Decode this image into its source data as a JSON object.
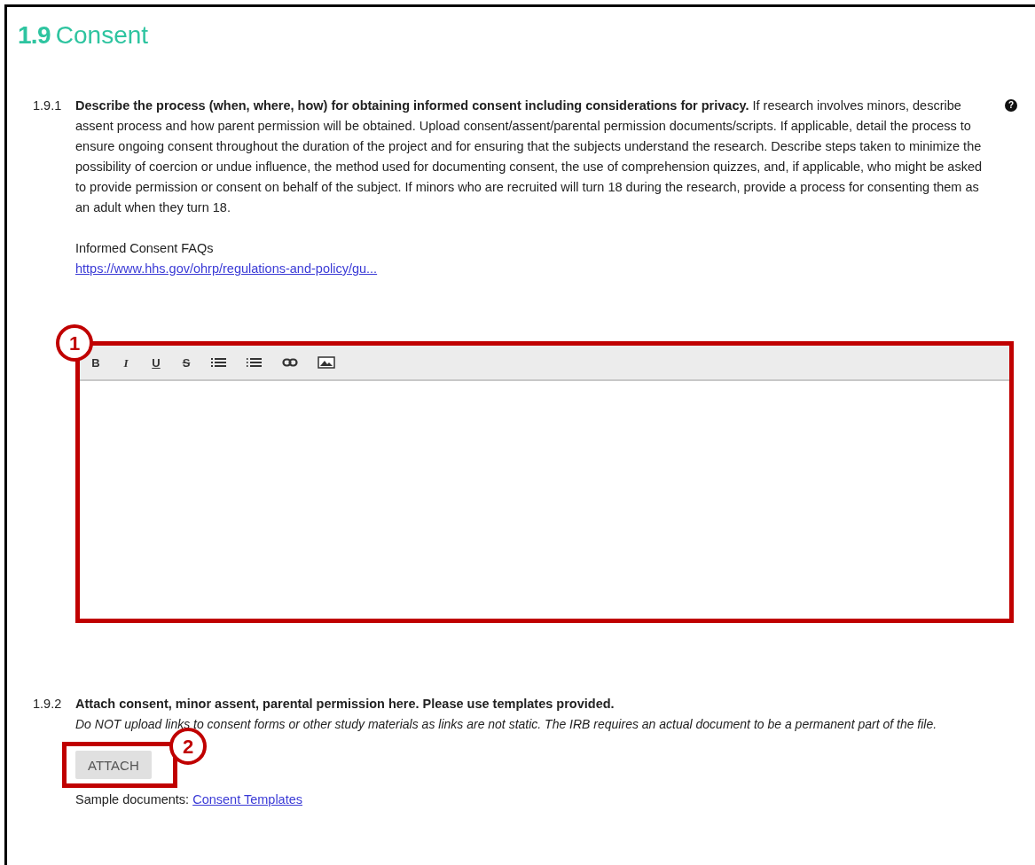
{
  "section": {
    "number": "1.9",
    "title": "Consent"
  },
  "questions": [
    {
      "kind": "editor",
      "number": "1.9.1",
      "text": "**Describe the process (when, where, how) for obtaining informed consent including considerations for privacy.** If research involves minors, describe assent process and how parent permission will be obtained. Upload consent/assent/parental permission documents/scripts. If applicable, detail the process to ensure ongoing consent throughout the duration of the project and for ensuring that the subjects understand the research. Describe steps taken to minimize the possibility of coercion or undue influence, the method used for documenting consent, the use of comprehension quizzes, and, if applicable, who might be asked to provide permission or consent on behalf of the subject. If minors who are recruited will turn 18 during the research, provide a process for consenting them as an adult when they turn 18.",
      "help": "?",
      "link_label": "Informed Consent FAQs",
      "link": "https://www.hhs.gov/ohrp/regulations-and-policy/gu...",
      "toolbar": [
        {
          "kind": "bold",
          "label": "B"
        },
        {
          "kind": "italic",
          "label": "I"
        },
        {
          "kind": "underline",
          "label": "U"
        },
        {
          "kind": "strike",
          "label": "S"
        },
        {
          "kind": "bullets"
        },
        {
          "kind": "numbers"
        },
        {
          "kind": "link"
        },
        {
          "kind": "image"
        }
      ],
      "callout": "1"
    },
    {
      "kind": "attach",
      "number": "1.9.2",
      "text": "Attach consent, minor assent, parental permission here.  Please use templates provided.",
      "note": "Do NOT upload links to consent forms or other study materials as links are not static. The IRB requires an actual document to be a permanent part of the file.",
      "button": "ATTACH",
      "callout": "2",
      "sample_label": "Sample documents:",
      "sample_link": "Consent Templates"
    }
  ]
}
